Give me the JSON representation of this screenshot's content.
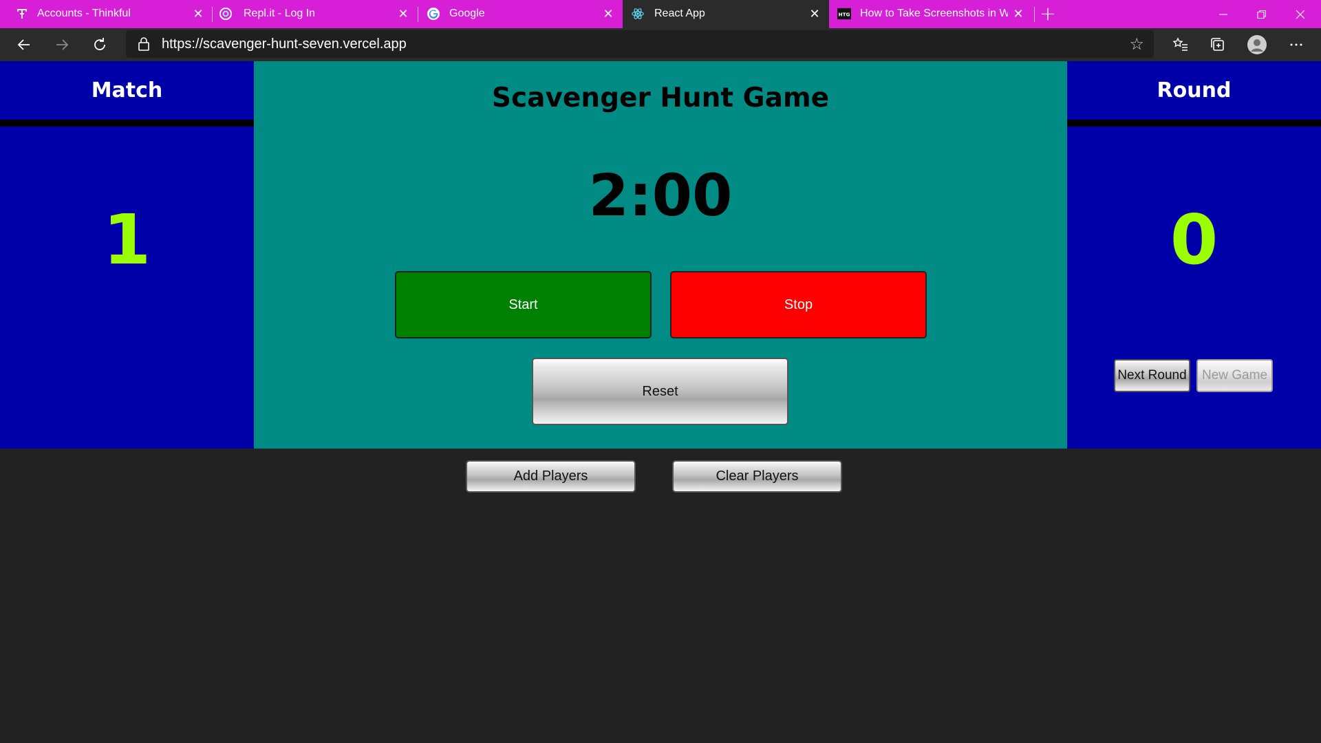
{
  "browser": {
    "tabs": [
      {
        "title": "Accounts - Thinkful",
        "favicon": "thinkful-icon",
        "active": false
      },
      {
        "title": "Repl.it - Log In",
        "favicon": "replit-icon",
        "active": false
      },
      {
        "title": "Google",
        "favicon": "google-icon",
        "active": false
      },
      {
        "title": "React App",
        "favicon": "react-icon",
        "active": true
      },
      {
        "title": "How to Take Screenshots in Wind",
        "favicon": "htg-icon",
        "active": false
      }
    ],
    "url": "https://scavenger-hunt-seven.vercel.app",
    "accent_color": "#d61fd6"
  },
  "match": {
    "label": "Match",
    "value": "1"
  },
  "round": {
    "label": "Round",
    "value": "0"
  },
  "game": {
    "title": "Scavenger Hunt Game",
    "timer": "2:00",
    "start_label": "Start",
    "stop_label": "Stop",
    "reset_label": "Reset"
  },
  "round_controls": {
    "next_round_label": "Next Round",
    "new_game_label": "New Game"
  },
  "players": {
    "add_label": "Add Players",
    "clear_label": "Clear Players"
  },
  "colors": {
    "side_panel": "#0000a8",
    "center_panel": "#008b85",
    "score": "#9aff00",
    "start": "#008000",
    "stop": "#ff0000"
  }
}
